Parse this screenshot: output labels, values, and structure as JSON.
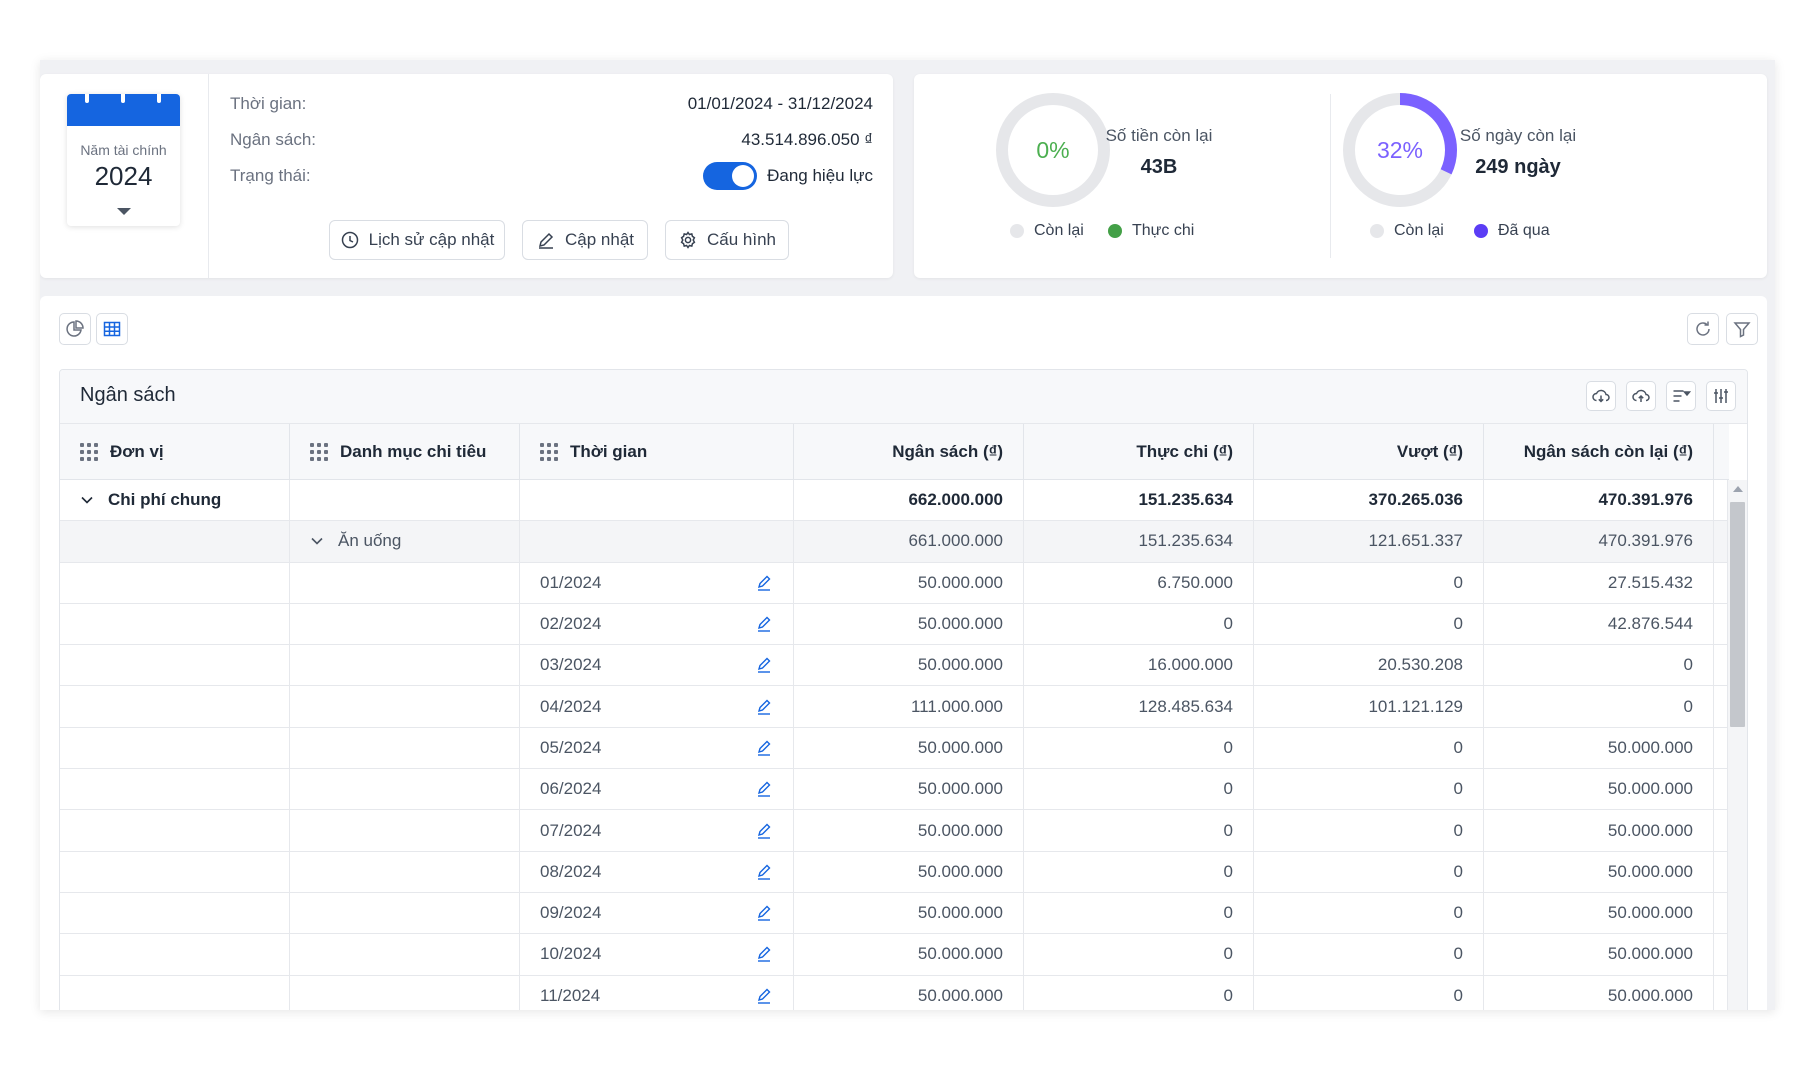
{
  "fiscal": {
    "label": "Năm tài chính",
    "year": "2024"
  },
  "info": {
    "time_label": "Thời gian:",
    "time_value": "01/01/2024 - 31/12/2024",
    "budget_label": "Ngân sách:",
    "budget_value": "43.514.896.050 ₫",
    "status_label": "Trạng thái:",
    "status_value": "Đang hiệu lực",
    "status_on": true
  },
  "actions": {
    "history": "Lịch sử cập nhật",
    "update": "Cập nhật",
    "config": "Cấu hình"
  },
  "stats": {
    "money": {
      "percent_text": "0%",
      "percent": 0,
      "title": "Số tiền còn lại",
      "value": "43B",
      "legend_remaining": "Còn lại",
      "legend_spent": "Thực chi",
      "color": "#4caf50"
    },
    "days": {
      "percent_text": "32%",
      "percent": 32,
      "title": "Số ngày còn lại",
      "value": "249 ngày",
      "legend_remaining": "Còn lại",
      "legend_passed": "Đã qua",
      "color": "#7b61ff"
    }
  },
  "table": {
    "title": "Ngân sách",
    "columns": [
      "Đơn vị",
      "Danh mục chi tiêu",
      "Thời gian",
      "Ngân sách (₫)",
      "Thực chi (₫)",
      "Vượt (₫)",
      "Ngân sách còn lại (₫)"
    ],
    "group1": {
      "name": "Chi phí chung",
      "budget": "662.000.000",
      "spent": "151.235.634",
      "over": "370.265.036",
      "remaining": "470.391.976"
    },
    "group2": {
      "name": "Ăn uống",
      "budget": "661.000.000",
      "spent": "151.235.634",
      "over": "121.651.337",
      "remaining": "470.391.976"
    },
    "rows": [
      {
        "period": "01/2024",
        "budget": "50.000.000",
        "spent": "6.750.000",
        "over": "0",
        "remaining": "27.515.432"
      },
      {
        "period": "02/2024",
        "budget": "50.000.000",
        "spent": "0",
        "over": "0",
        "remaining": "42.876.544"
      },
      {
        "period": "03/2024",
        "budget": "50.000.000",
        "spent": "16.000.000",
        "over": "20.530.208",
        "remaining": "0"
      },
      {
        "period": "04/2024",
        "budget": "111.000.000",
        "spent": "128.485.634",
        "over": "101.121.129",
        "remaining": "0"
      },
      {
        "period": "05/2024",
        "budget": "50.000.000",
        "spent": "0",
        "over": "0",
        "remaining": "50.000.000"
      },
      {
        "period": "06/2024",
        "budget": "50.000.000",
        "spent": "0",
        "over": "0",
        "remaining": "50.000.000"
      },
      {
        "period": "07/2024",
        "budget": "50.000.000",
        "spent": "0",
        "over": "0",
        "remaining": "50.000.000"
      },
      {
        "period": "08/2024",
        "budget": "50.000.000",
        "spent": "0",
        "over": "0",
        "remaining": "50.000.000"
      },
      {
        "period": "09/2024",
        "budget": "50.000.000",
        "spent": "0",
        "over": "0",
        "remaining": "50.000.000"
      },
      {
        "period": "10/2024",
        "budget": "50.000.000",
        "spent": "0",
        "over": "0",
        "remaining": "50.000.000"
      },
      {
        "period": "11/2024",
        "budget": "50.000.000",
        "spent": "0",
        "over": "0",
        "remaining": "50.000.000"
      }
    ]
  },
  "colors": {
    "accent": "#1565e0",
    "donut_track": "#e6e7ea",
    "money_pct": "#4caf50",
    "days_pct": "#7b61ff"
  }
}
